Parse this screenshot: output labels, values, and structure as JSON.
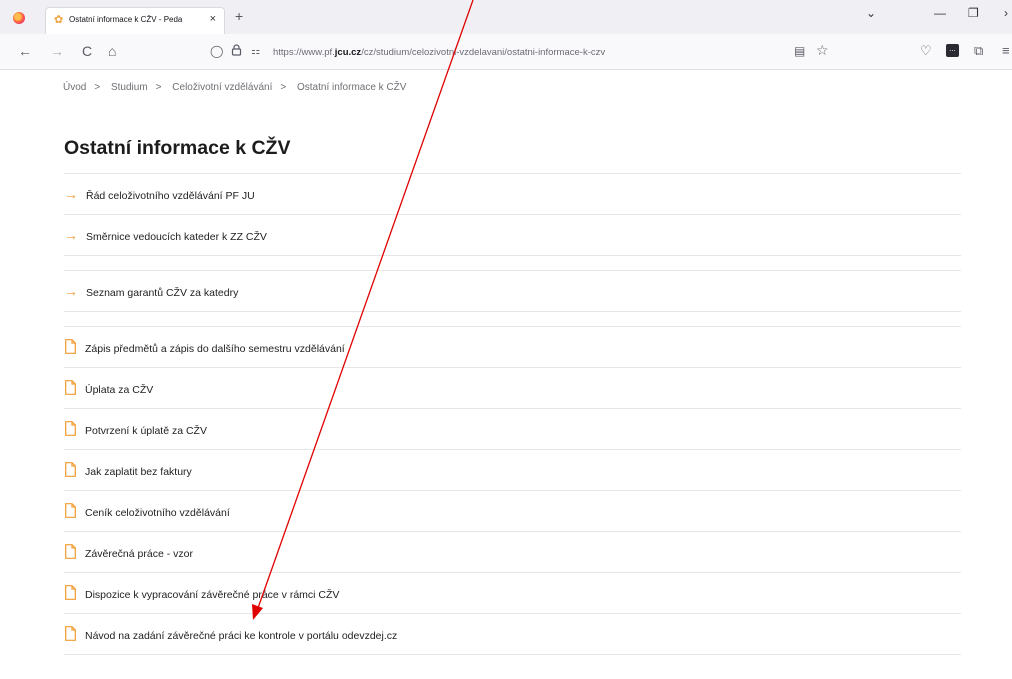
{
  "browser": {
    "tab_title": "Ostatní informace k CŽV - Peda",
    "tab_close": "×",
    "new_tab": "+",
    "url_prefix": "https://www.pf.",
    "url_host_bold": "jcu.cz",
    "url_path": "/cz/studium/celozivotni-vzdelavani/ostatni-informace-k-czv",
    "icons": {
      "back": "←",
      "forward": "→",
      "reload": "C",
      "home": "⌂",
      "shield": "◯",
      "lock": "🔒",
      "permissions": "⚏",
      "reader": "▤",
      "bookmark": "☆",
      "pocket": "♡",
      "extensions": "⧉",
      "menu": "≡",
      "dropdown": "⌄",
      "minimize": "—",
      "restore": "❐",
      "more": "›"
    }
  },
  "breadcrumb": {
    "items": [
      "Úvod",
      "Studium",
      "Celoživotní vzdělávání",
      "Ostatní informace k CŽV"
    ],
    "separator": ">"
  },
  "page": {
    "title": "Ostatní informace k CŽV",
    "arrow_glyph": "→",
    "accent_color": "#f29a2e",
    "links": [
      "Řád celoživotního vzdělávání PF JU",
      "Směrnice vedoucích kateder k ZZ CŽV",
      "Seznam garantů CŽV za katedry"
    ],
    "documents": [
      "Zápis předmětů a zápis do dalšího semestru vzdělávání",
      "Úplata za CŽV",
      "Potvrzení k úplatě za CŽV",
      "Jak zaplatit bez faktury",
      "Ceník celoživotního vzdělávání",
      "Závěrečná práce - vzor",
      "Dispozice k vypracování závěrečné práce v rámci CŽV",
      "Návod na zadání závěrečné práci ke kontrole v portálu odevzdej.cz"
    ]
  },
  "annotation": {
    "color": "#e00000"
  }
}
